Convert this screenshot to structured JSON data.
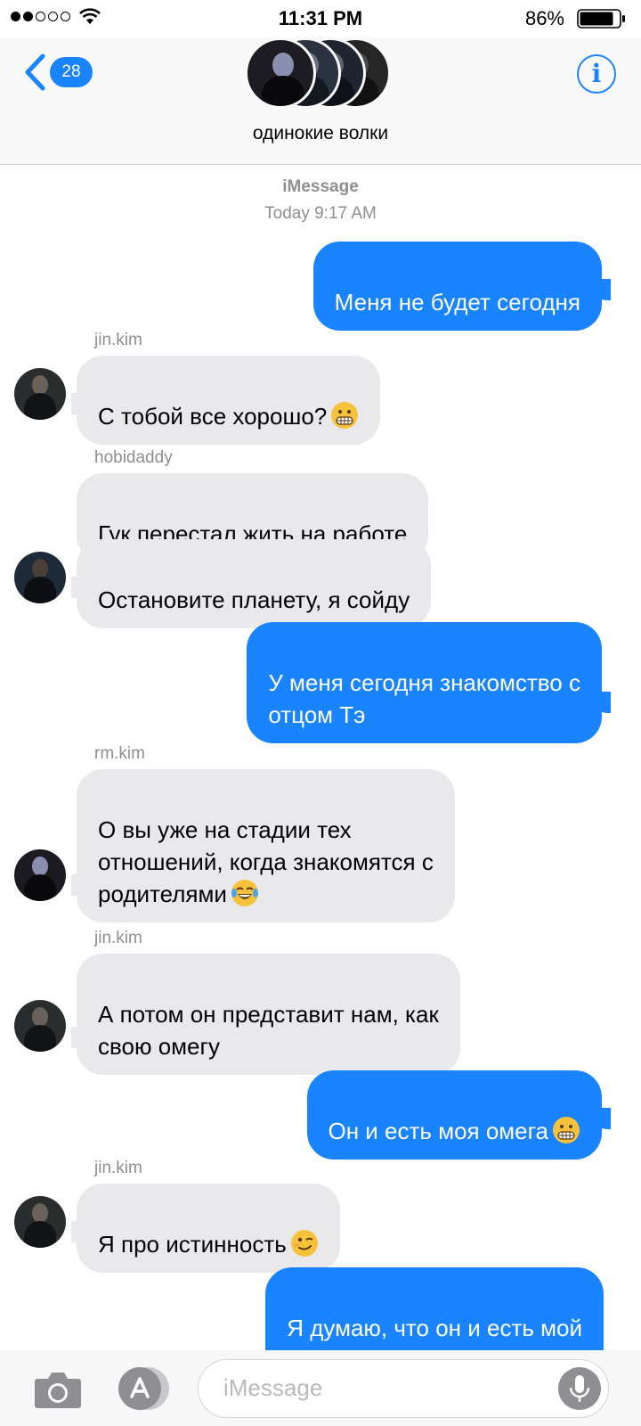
{
  "status_bar": {
    "time": "11:31 PM",
    "battery_percent": "86%",
    "battery_level": 0.86,
    "signal_bars_filled": 2,
    "signal_bars_total": 5
  },
  "header": {
    "back_badge": "28",
    "group_name": "одинокие волки",
    "info_label": "i",
    "avatar_colors": [
      "#1c1c22",
      "#2b3340",
      "#1e2430",
      "#3a3a3a"
    ]
  },
  "thread": {
    "service": "iMessage",
    "timestamp": "Today 9:17 AM",
    "messages": [
      {
        "direction": "out",
        "text": "Меня не будет сегодня"
      },
      {
        "direction": "in",
        "sender": "jin.kim",
        "text": "С тобой все хорошо?",
        "emoji": "grimacing-face"
      },
      {
        "direction": "in",
        "sender": "hobidaddy",
        "text": "Гук перестал жить на работе"
      },
      {
        "direction": "in",
        "text": "Остановите планету, я сойду"
      },
      {
        "direction": "out",
        "text": "У меня сегодня знакомство с\nотцом Тэ"
      },
      {
        "direction": "in",
        "sender": "rm.kim",
        "text": "О вы уже на стадии тех\nотношений, когда знакомятся с\nродителями",
        "emoji": "tears-of-joy-face"
      },
      {
        "direction": "in",
        "sender": "jin.kim",
        "text": "А потом он представит нам, как\nсвою омегу"
      },
      {
        "direction": "out",
        "text": "Он и есть моя омега",
        "emoji": "grimacing-face"
      },
      {
        "direction": "in",
        "sender": "jin.kim",
        "text": "Я про истинность",
        "emoji": "winking-face"
      },
      {
        "direction": "out",
        "text": "Я думаю, что он и есть мой"
      }
    ]
  },
  "compose": {
    "placeholder": "iMessage"
  },
  "colors": {
    "accent": "#1a83ff",
    "incoming_bubble": "#e9e9eb",
    "meta_gray": "#8e8e93"
  }
}
